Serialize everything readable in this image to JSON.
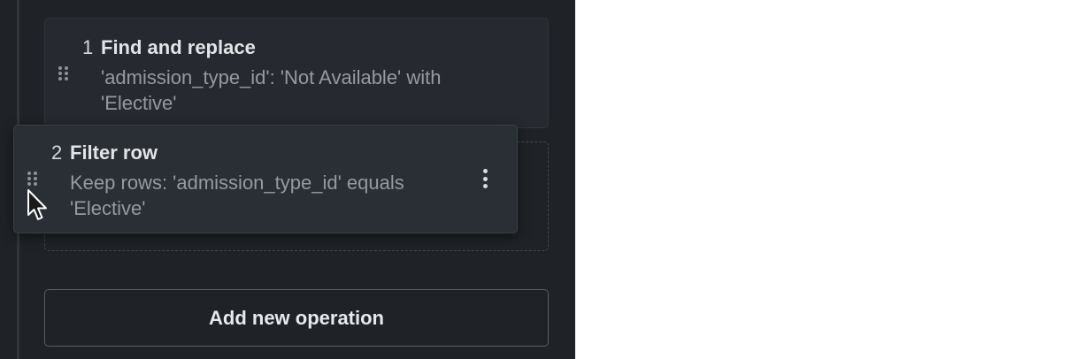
{
  "operations": [
    {
      "number": "1",
      "title": "Find and replace",
      "description": "'admission_type_id': 'Not Available' with 'Elective'"
    },
    {
      "number": "2",
      "title": "Filter row",
      "description": "Keep rows: 'admission_type_id' equals 'Elective'"
    }
  ],
  "add_button_label": "Add new operation",
  "icons": {
    "drag_handle": "drag-handle-icon",
    "more": "more-vertical-icon",
    "cursor": "mouse-pointer-icon"
  },
  "colors": {
    "panel_background": "#1f2226",
    "card_background": "#262a30",
    "dragging_card_background": "#2a2e35",
    "title_text": "#e2e4e6",
    "description_text": "#959aa1"
  }
}
